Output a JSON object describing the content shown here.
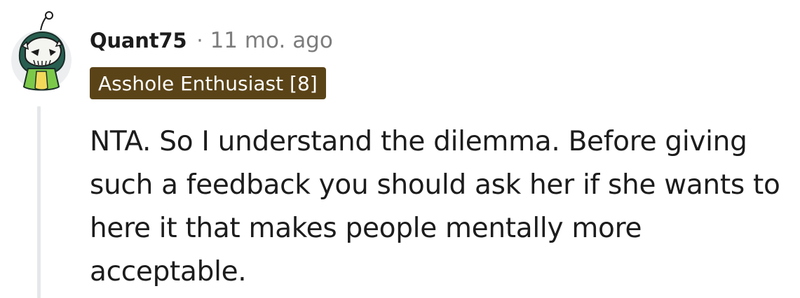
{
  "comment": {
    "avatar_icon": "snoo-avatar-skull-mask-icon",
    "author": "Quant75",
    "separator": "·",
    "timestamp": "11 mo. ago",
    "flair": "Asshole Enthusiast [8]",
    "body": "NTA. So I understand the dilemma. Before giving such a feedback you should ask her if she wants to here it that makes people mentally more acceptable."
  },
  "colors": {
    "flair_bg": "#5a4317",
    "flair_text": "#ffffff",
    "author": "#1c1c1c",
    "meta": "#7c7c7c",
    "body": "#1c1c1c",
    "thread_line": "#e5e7e9"
  }
}
